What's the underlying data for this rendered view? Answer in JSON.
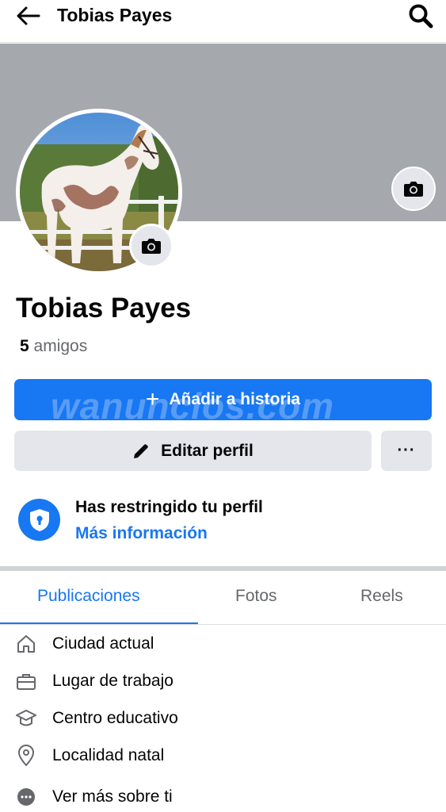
{
  "header": {
    "title": "Tobias Payes"
  },
  "profile": {
    "name": "Tobias Payes",
    "friends_count": "5",
    "friends_label": "amigos"
  },
  "actions": {
    "add_story_label": "Añadir a historia",
    "edit_profile_label": "Editar perfil",
    "more_label": "···"
  },
  "watermark": "wanuncios.com",
  "restriction": {
    "title": "Has restringido tu perfil",
    "link": "Más información"
  },
  "tabs": [
    {
      "label": "Publicaciones",
      "active": true
    },
    {
      "label": "Fotos",
      "active": false
    },
    {
      "label": "Reels",
      "active": false
    }
  ],
  "details": [
    {
      "icon": "home-icon",
      "label": "Ciudad actual"
    },
    {
      "icon": "briefcase-icon",
      "label": "Lugar de trabajo"
    },
    {
      "icon": "graduation-cap-icon",
      "label": "Centro educativo"
    },
    {
      "icon": "location-pin-icon",
      "label": "Localidad natal"
    },
    {
      "icon": "more-dots-icon",
      "label": "Ver más sobre ti"
    }
  ],
  "colors": {
    "accent": "#1877f2",
    "cover": "#a5a8ad",
    "button_gray": "#e4e6eb"
  }
}
